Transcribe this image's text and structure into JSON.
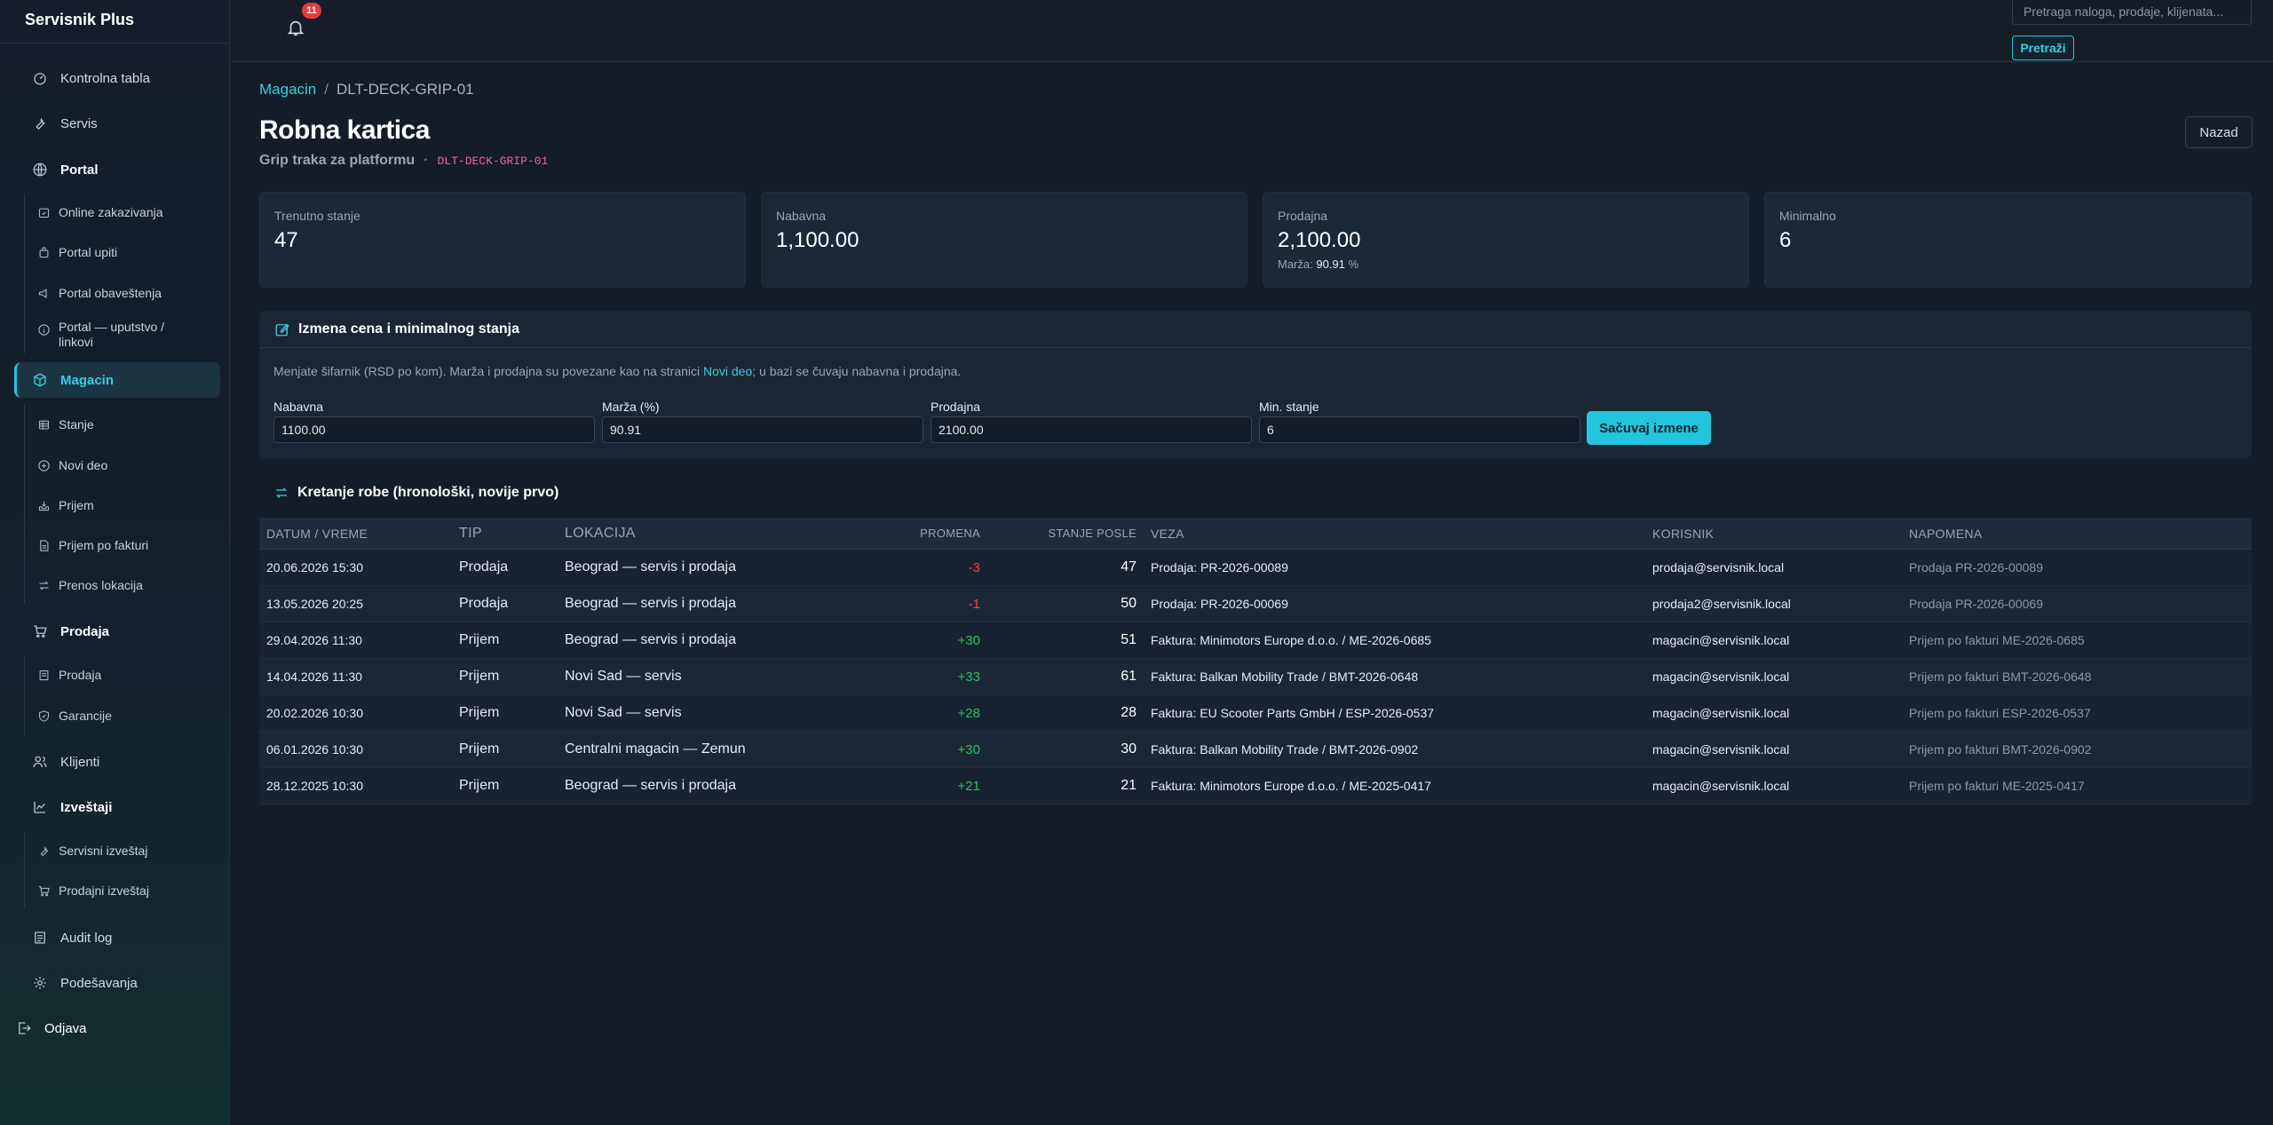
{
  "app": {
    "brand": "Servisnik Plus"
  },
  "sidebar": {
    "items": [
      {
        "label": "Kontrolna tabla",
        "icon": "dashboard-icon"
      },
      {
        "label": "Servis",
        "icon": "wrench-icon"
      },
      {
        "label": "Portal",
        "icon": "globe-icon"
      },
      {
        "label": "Magacin",
        "icon": "box-icon"
      },
      {
        "label": "Prodaja",
        "icon": "cart-icon"
      },
      {
        "label": "Klijenti",
        "icon": "users-icon"
      },
      {
        "label": "Izveštaji",
        "icon": "chart-icon"
      },
      {
        "label": "Audit log",
        "icon": "list-icon"
      },
      {
        "label": "Podešavanja",
        "icon": "gear-icon"
      },
      {
        "label": "Odjava",
        "icon": "logout-icon"
      }
    ],
    "portal_sub": [
      "Online zakazivanja",
      "Portal upiti",
      "Portal obaveštenja",
      "Portal — uputstvo / linkovi"
    ],
    "magacin_sub": [
      "Stanje",
      "Novi deo",
      "Prijem",
      "Prijem po fakturi",
      "Prenos lokacija"
    ],
    "prodaja_sub": [
      "Prodaja",
      "Garancije"
    ],
    "izvestaji_sub": [
      "Servisni izveštaj",
      "Prodajni izveštaj"
    ]
  },
  "header": {
    "notifications_count": "11",
    "search_placeholder": "Pretraga naloga, prodaje, klijenata...",
    "search_button": "Pretraži"
  },
  "breadcrumb": {
    "parent": "Magacin",
    "current": "DLT-DECK-GRIP-01"
  },
  "page": {
    "title": "Robna kartica",
    "subtitle": "Grip traka za platformu",
    "code": "DLT-DECK-GRIP-01",
    "back": "Nazad"
  },
  "stats": {
    "current_label": "Trenutno stanje",
    "current_value": "47",
    "purchase_label": "Nabavna",
    "purchase_value": "1,100.00",
    "sale_label": "Prodajna",
    "sale_value": "2,100.00",
    "margin_label": "Marža:",
    "margin_value": "90.91",
    "margin_unit": "%",
    "min_label": "Minimalno",
    "min_value": "6"
  },
  "edit": {
    "title": "Izmena cena i minimalnog stanja",
    "desc_before": "Menjate šifarnik (RSD po kom). Marža i prodajna su povezane kao na stranici ",
    "desc_link": "Novi deo",
    "desc_after": "; u bazi se čuvaju nabavna i prodajna.",
    "purchase_label": "Nabavna",
    "purchase_value": "1100.00",
    "margin_label": "Marža (%)",
    "margin_value": "90.91",
    "sale_label": "Prodajna",
    "sale_value": "2100.00",
    "min_label": "Min. stanje",
    "min_value": "6",
    "save": "Sačuvaj izmene"
  },
  "movements": {
    "title": "Kretanje robe (hronološki, novije prvo)",
    "columns": [
      "Datum / vreme",
      "Tip",
      "Lokacija",
      "Promena",
      "Stanje posle",
      "Veza",
      "Korisnik",
      "Napomena"
    ],
    "rows": [
      {
        "date": "20.06.2026 15:30",
        "type": "Prodaja",
        "location": "Beograd — servis i prodaja",
        "change": "-3",
        "after": "47",
        "link": "Prodaja: PR-2026-00089",
        "user": "prodaja@servisnik.local",
        "note": "Prodaja PR-2026-00089"
      },
      {
        "date": "13.05.2026 20:25",
        "type": "Prodaja",
        "location": "Beograd — servis i prodaja",
        "change": "-1",
        "after": "50",
        "link": "Prodaja: PR-2026-00069",
        "user": "prodaja2@servisnik.local",
        "note": "Prodaja PR-2026-00069"
      },
      {
        "date": "29.04.2026 11:30",
        "type": "Prijem",
        "location": "Beograd — servis i prodaja",
        "change": "+30",
        "after": "51",
        "link": "Faktura: Minimotors Europe d.o.o. / ME-2026-0685",
        "user": "magacin@servisnik.local",
        "note": "Prijem po fakturi ME-2026-0685"
      },
      {
        "date": "14.04.2026 11:30",
        "type": "Prijem",
        "location": "Novi Sad — servis",
        "change": "+33",
        "after": "61",
        "link": "Faktura: Balkan Mobility Trade / BMT-2026-0648",
        "user": "magacin@servisnik.local",
        "note": "Prijem po fakturi BMT-2026-0648"
      },
      {
        "date": "20.02.2026 10:30",
        "type": "Prijem",
        "location": "Novi Sad — servis",
        "change": "+28",
        "after": "28",
        "link": "Faktura: EU Scooter Parts GmbH / ESP-2026-0537",
        "user": "magacin@servisnik.local",
        "note": "Prijem po fakturi ESP-2026-0537"
      },
      {
        "date": "06.01.2026 10:30",
        "type": "Prijem",
        "location": "Centralni magacin — Zemun",
        "change": "+30",
        "after": "30",
        "link": "Faktura: Balkan Mobility Trade / BMT-2026-0902",
        "user": "magacin@servisnik.local",
        "note": "Prijem po fakturi BMT-2026-0902"
      },
      {
        "date": "28.12.2025 10:30",
        "type": "Prijem",
        "location": "Beograd — servis i prodaja",
        "change": "+21",
        "after": "21",
        "link": "Faktura: Minimotors Europe d.o.o. / ME-2025-0417",
        "user": "magacin@servisnik.local",
        "note": "Prijem po fakturi ME-2025-0417"
      }
    ]
  },
  "colors": {
    "accent": "#22c5dc",
    "negative": "#ef4444",
    "positive": "#22c55e"
  }
}
